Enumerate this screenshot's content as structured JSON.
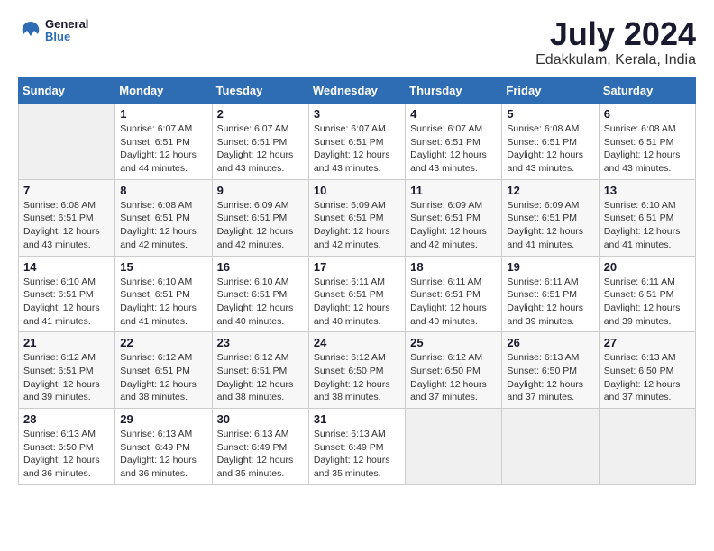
{
  "logo": {
    "text_general": "General",
    "text_blue": "Blue"
  },
  "title": "July 2024",
  "location": "Edakkulam, Kerala, India",
  "days_of_week": [
    "Sunday",
    "Monday",
    "Tuesday",
    "Wednesday",
    "Thursday",
    "Friday",
    "Saturday"
  ],
  "weeks": [
    [
      {
        "day": "",
        "info": ""
      },
      {
        "day": "1",
        "info": "Sunrise: 6:07 AM\nSunset: 6:51 PM\nDaylight: 12 hours\nand 44 minutes."
      },
      {
        "day": "2",
        "info": "Sunrise: 6:07 AM\nSunset: 6:51 PM\nDaylight: 12 hours\nand 43 minutes."
      },
      {
        "day": "3",
        "info": "Sunrise: 6:07 AM\nSunset: 6:51 PM\nDaylight: 12 hours\nand 43 minutes."
      },
      {
        "day": "4",
        "info": "Sunrise: 6:07 AM\nSunset: 6:51 PM\nDaylight: 12 hours\nand 43 minutes."
      },
      {
        "day": "5",
        "info": "Sunrise: 6:08 AM\nSunset: 6:51 PM\nDaylight: 12 hours\nand 43 minutes."
      },
      {
        "day": "6",
        "info": "Sunrise: 6:08 AM\nSunset: 6:51 PM\nDaylight: 12 hours\nand 43 minutes."
      }
    ],
    [
      {
        "day": "7",
        "info": ""
      },
      {
        "day": "8",
        "info": "Sunrise: 6:08 AM\nSunset: 6:51 PM\nDaylight: 12 hours\nand 42 minutes."
      },
      {
        "day": "9",
        "info": "Sunrise: 6:09 AM\nSunset: 6:51 PM\nDaylight: 12 hours\nand 42 minutes."
      },
      {
        "day": "10",
        "info": "Sunrise: 6:09 AM\nSunset: 6:51 PM\nDaylight: 12 hours\nand 42 minutes."
      },
      {
        "day": "11",
        "info": "Sunrise: 6:09 AM\nSunset: 6:51 PM\nDaylight: 12 hours\nand 42 minutes."
      },
      {
        "day": "12",
        "info": "Sunrise: 6:09 AM\nSunset: 6:51 PM\nDaylight: 12 hours\nand 41 minutes."
      },
      {
        "day": "13",
        "info": "Sunrise: 6:10 AM\nSunset: 6:51 PM\nDaylight: 12 hours\nand 41 minutes."
      }
    ],
    [
      {
        "day": "14",
        "info": ""
      },
      {
        "day": "15",
        "info": "Sunrise: 6:10 AM\nSunset: 6:51 PM\nDaylight: 12 hours\nand 41 minutes."
      },
      {
        "day": "16",
        "info": "Sunrise: 6:10 AM\nSunset: 6:51 PM\nDaylight: 12 hours\nand 40 minutes."
      },
      {
        "day": "17",
        "info": "Sunrise: 6:11 AM\nSunset: 6:51 PM\nDaylight: 12 hours\nand 40 minutes."
      },
      {
        "day": "18",
        "info": "Sunrise: 6:11 AM\nSunset: 6:51 PM\nDaylight: 12 hours\nand 40 minutes."
      },
      {
        "day": "19",
        "info": "Sunrise: 6:11 AM\nSunset: 6:51 PM\nDaylight: 12 hours\nand 39 minutes."
      },
      {
        "day": "20",
        "info": "Sunrise: 6:11 AM\nSunset: 6:51 PM\nDaylight: 12 hours\nand 39 minutes."
      }
    ],
    [
      {
        "day": "21",
        "info": ""
      },
      {
        "day": "22",
        "info": "Sunrise: 6:12 AM\nSunset: 6:51 PM\nDaylight: 12 hours\nand 38 minutes."
      },
      {
        "day": "23",
        "info": "Sunrise: 6:12 AM\nSunset: 6:51 PM\nDaylight: 12 hours\nand 38 minutes."
      },
      {
        "day": "24",
        "info": "Sunrise: 6:12 AM\nSunset: 6:50 PM\nDaylight: 12 hours\nand 38 minutes."
      },
      {
        "day": "25",
        "info": "Sunrise: 6:12 AM\nSunset: 6:50 PM\nDaylight: 12 hours\nand 37 minutes."
      },
      {
        "day": "26",
        "info": "Sunrise: 6:13 AM\nSunset: 6:50 PM\nDaylight: 12 hours\nand 37 minutes."
      },
      {
        "day": "27",
        "info": "Sunrise: 6:13 AM\nSunset: 6:50 PM\nDaylight: 12 hours\nand 37 minutes."
      }
    ],
    [
      {
        "day": "28",
        "info": "Sunrise: 6:13 AM\nSunset: 6:50 PM\nDaylight: 12 hours\nand 36 minutes."
      },
      {
        "day": "29",
        "info": "Sunrise: 6:13 AM\nSunset: 6:49 PM\nDaylight: 12 hours\nand 36 minutes."
      },
      {
        "day": "30",
        "info": "Sunrise: 6:13 AM\nSunset: 6:49 PM\nDaylight: 12 hours\nand 35 minutes."
      },
      {
        "day": "31",
        "info": "Sunrise: 6:13 AM\nSunset: 6:49 PM\nDaylight: 12 hours\nand 35 minutes."
      },
      {
        "day": "",
        "info": ""
      },
      {
        "day": "",
        "info": ""
      },
      {
        "day": "",
        "info": ""
      }
    ]
  ],
  "week1_day7_special": "Sunrise: 6:08 AM\nSunset: 6:51 PM\nDaylight: 12 hours\nand 43 minutes.",
  "week2_day14": "Sunrise: 6:10 AM\nSunset: 6:51 PM\nDaylight: 12 hours\nand 41 minutes.",
  "week3_day21": "Sunrise: 6:12 AM\nSunset: 6:51 PM\nDaylight: 12 hours\nand 39 minutes."
}
